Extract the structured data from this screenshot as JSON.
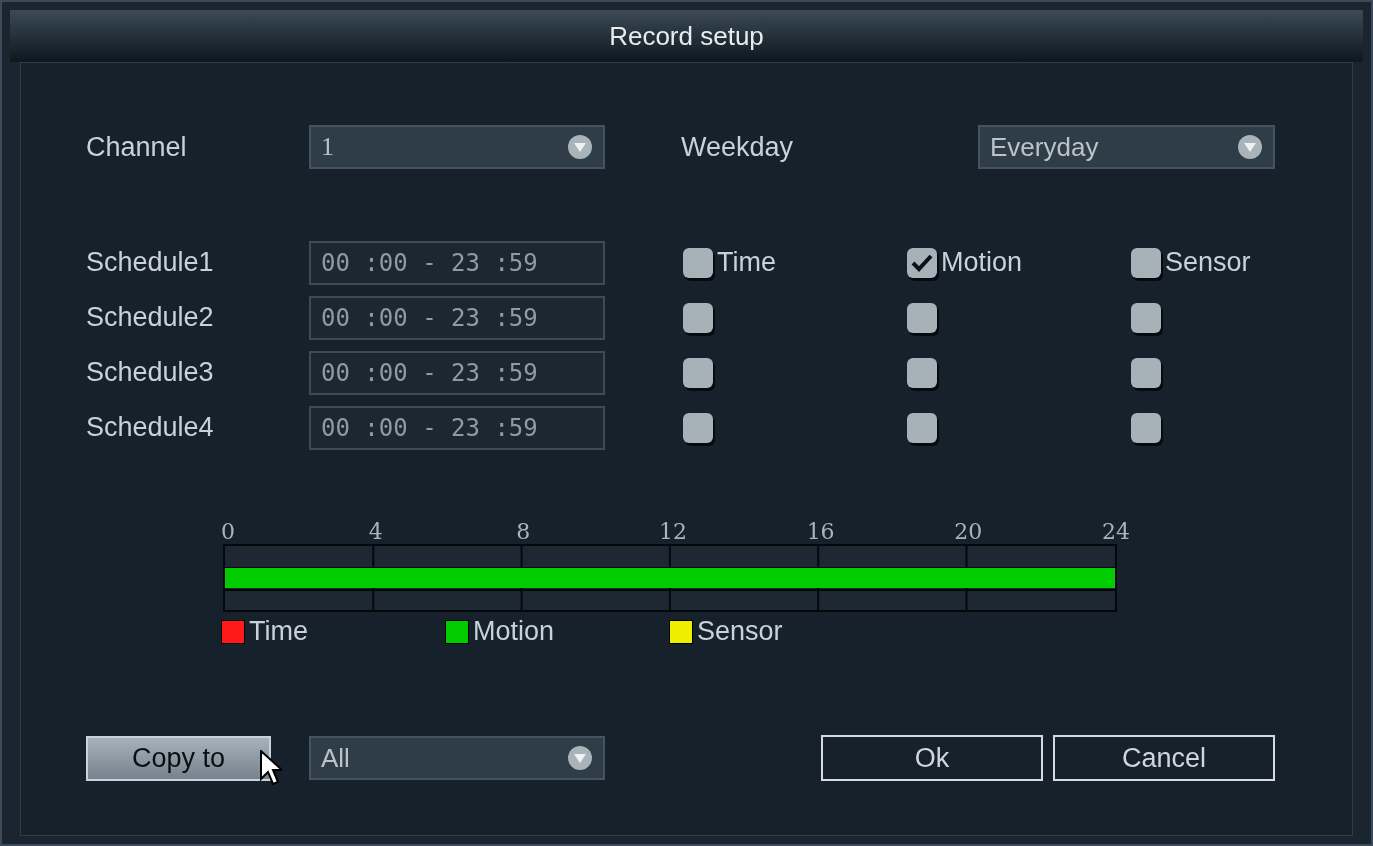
{
  "window": {
    "title": "Record setup"
  },
  "channel": {
    "label": "Channel",
    "value": "1"
  },
  "weekday": {
    "label": "Weekday",
    "value": "Everyday"
  },
  "modes": [
    "Time",
    "Motion",
    "Sensor"
  ],
  "schedules": [
    {
      "label": "Schedule1",
      "range": "00 :00 - 23 :59",
      "checks": [
        false,
        true,
        false
      ]
    },
    {
      "label": "Schedule2",
      "range": "00 :00 - 23 :59",
      "checks": [
        false,
        false,
        false
      ]
    },
    {
      "label": "Schedule3",
      "range": "00 :00 - 23 :59",
      "checks": [
        false,
        false,
        false
      ]
    },
    {
      "label": "Schedule4",
      "range": "00 :00 - 23 :59",
      "checks": [
        false,
        false,
        false
      ]
    }
  ],
  "timeline": {
    "ticks": [
      "0",
      "4",
      "8",
      "12",
      "16",
      "20",
      "24"
    ],
    "segments": [
      {
        "color": "#00cc00",
        "level": 1
      }
    ]
  },
  "legend": [
    {
      "label": "Time",
      "color": "#ff1a1a"
    },
    {
      "label": "Motion",
      "color": "#00cc00"
    },
    {
      "label": "Sensor",
      "color": "#eeee00"
    }
  ],
  "copy": {
    "button": "Copy to",
    "target": "All"
  },
  "buttons": [
    "Ok",
    "Cancel"
  ]
}
